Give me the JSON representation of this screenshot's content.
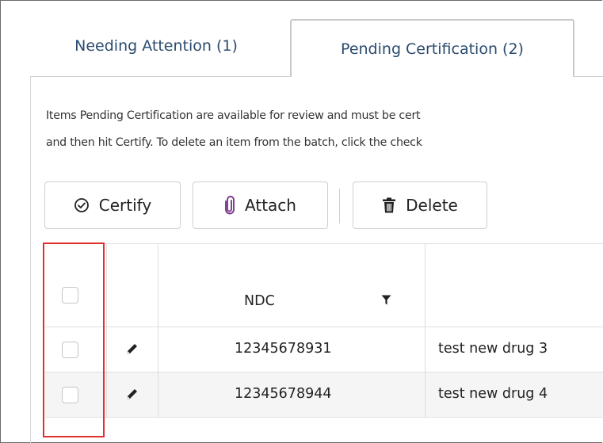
{
  "tabs": [
    {
      "label": "Needing Attention (1)",
      "active": false
    },
    {
      "label": "Pending Certification (2)",
      "active": true
    }
  ],
  "description": {
    "line1": "Items Pending Certification are available for review and must be cert",
    "line2": "and then hit Certify. To delete an item from the batch, click the check"
  },
  "toolbar": {
    "certify_label": "Certify",
    "attach_label": "Attach",
    "delete_label": "Delete",
    "certify_icon": "check-circle-icon",
    "attach_icon": "paperclip-icon",
    "delete_icon": "trash-icon"
  },
  "grid": {
    "columns": {
      "ndc": "NDC"
    },
    "rows": [
      {
        "ndc": "12345678931",
        "name": "test new drug 3",
        "checked": false
      },
      {
        "ndc": "12345678944",
        "name": "test new drug 4",
        "checked": false
      }
    ]
  },
  "colors": {
    "tab_text": "#2b4c6f",
    "highlight": "#e0302e",
    "alt_row": "#f5f5f5"
  }
}
